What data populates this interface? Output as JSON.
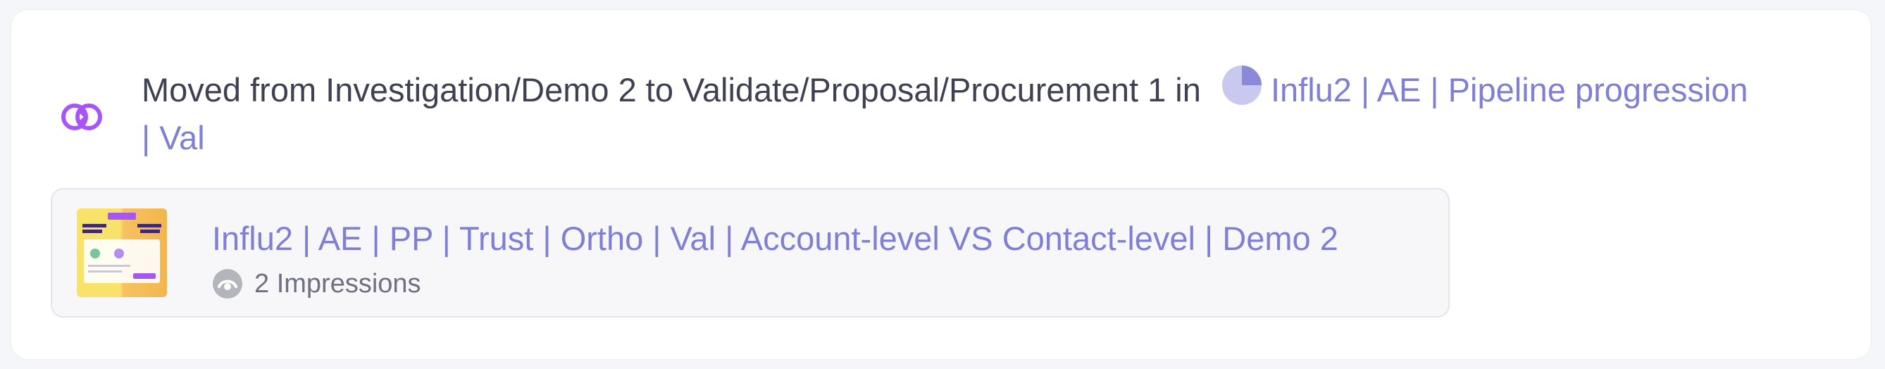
{
  "activity": {
    "icon": "stage-move-icon",
    "text": "Moved from Investigation/Demo 2 to Validate/Proposal/Procurement 1 in",
    "campaign_icon": "pie-chart-icon",
    "campaign_link": "Influ2 | AE | Pipeline progression | Val"
  },
  "asset": {
    "thumbnail_icon": "ad-creative-thumbnail",
    "title": "Influ2 | AE | PP | Trust | Ortho | Val | Account-level VS Contact-level | Demo 2",
    "impressions_icon": "eye-icon",
    "impressions": "2 Impressions"
  },
  "colors": {
    "accent_purple": "#a855f7",
    "link": "#7f7fd4",
    "text": "#3f4152"
  }
}
